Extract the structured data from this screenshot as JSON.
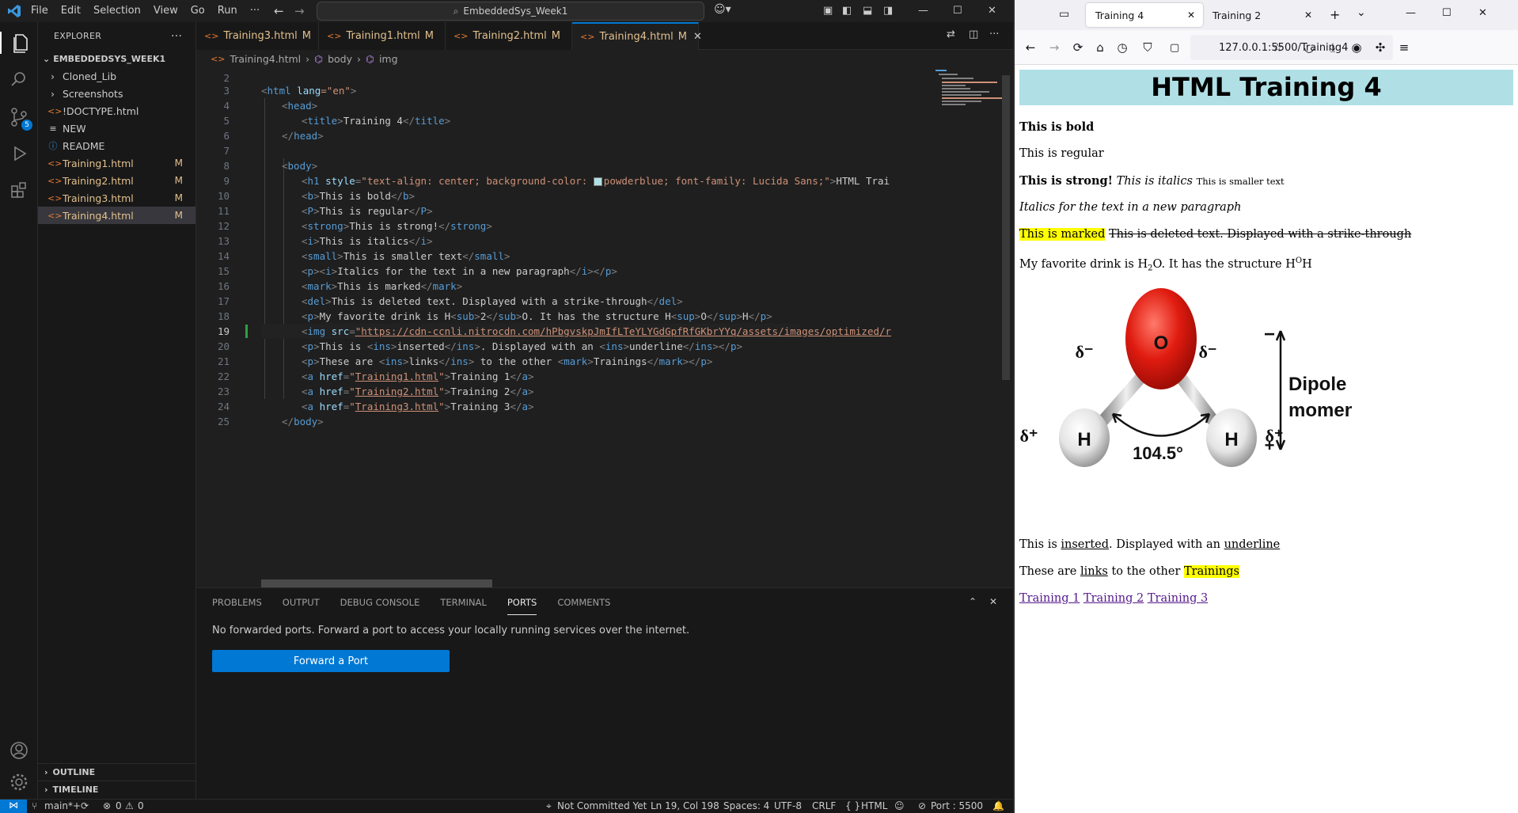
{
  "vscode": {
    "menu": [
      "File",
      "Edit",
      "Selection",
      "View",
      "Go",
      "Run",
      "···"
    ],
    "search_title": "EmbeddedSys_Week1",
    "explorer": {
      "header": "EXPLORER",
      "folder": "EMBEDDEDSYS_WEEK1",
      "items": [
        {
          "label": "Cloned_Lib",
          "kind": "folder",
          "status": ""
        },
        {
          "label": "Screenshots",
          "kind": "folder",
          "status": ""
        },
        {
          "label": "!DOCTYPE.html",
          "kind": "html",
          "status": ""
        },
        {
          "label": "NEW",
          "kind": "file",
          "status": ""
        },
        {
          "label": "README",
          "kind": "info",
          "status": ""
        },
        {
          "label": "Training1.html",
          "kind": "html",
          "status": "M"
        },
        {
          "label": "Training2.html",
          "kind": "html",
          "status": "M"
        },
        {
          "label": "Training3.html",
          "kind": "html",
          "status": "M"
        },
        {
          "label": "Training4.html",
          "kind": "html",
          "status": "M"
        }
      ],
      "outline": "OUTLINE",
      "timeline": "TIMELINE"
    },
    "source_control_badge": "5",
    "tabs": [
      {
        "label": "Training3.html",
        "mod": "M"
      },
      {
        "label": "Training1.html",
        "mod": "M"
      },
      {
        "label": "Training2.html",
        "mod": "M"
      },
      {
        "label": "Training4.html",
        "mod": "M"
      }
    ],
    "breadcrumb": [
      "Training4.html",
      "body",
      "img"
    ],
    "line_numbers": [
      "2",
      "3",
      "4",
      "5",
      "6",
      "7",
      "8",
      "9",
      "10",
      "11",
      "12",
      "13",
      "14",
      "15",
      "16",
      "17",
      "18",
      "19",
      "20",
      "21",
      "22",
      "23",
      "24",
      "25"
    ],
    "panel": {
      "tabs": [
        "PROBLEMS",
        "OUTPUT",
        "DEBUG CONSOLE",
        "TERMINAL",
        "PORTS",
        "COMMENTS"
      ],
      "active_tab": "PORTS",
      "message": "No forwarded ports. Forward a port to access your locally running services over the internet.",
      "button": "Forward a Port"
    },
    "status": {
      "branch": "main*+",
      "errors": "0",
      "warnings": "0",
      "commit": "Not Committed Yet",
      "position": "Ln 19, Col 198",
      "spaces": "Spaces: 4",
      "encoding": "UTF-8",
      "eol": "CRLF",
      "language": "HTML",
      "port": "Port : 5500"
    }
  },
  "code": {
    "l3a": "<",
    "l3b": "html",
    "l3c": " lang",
    "l3d": "=\"en\"",
    "l3e": ">",
    "l4": "head",
    "l5a": "title",
    "l5b": "Training 4",
    "l5c": "title",
    "l6": "head",
    "l8": "body",
    "l9a": "h1",
    "l9b": "style",
    "l9c": "\"text-align: center; background-color: ",
    "l9d": "powderblue; font-family: Lucida Sans;\"",
    "l9e": "HTML Trai",
    "l10a": "b",
    "l10b": "This is bold",
    "l10c": "b",
    "l11a": "P",
    "l11b": "This is regular",
    "l11c": "P",
    "l12a": "strong",
    "l12b": "This is strong!",
    "l12c": "strong",
    "l13a": "i",
    "l13b": "This is italics",
    "l13c": "i",
    "l14a": "small",
    "l14b": "This is smaller text",
    "l14c": "small",
    "l15a": "p",
    "l15b": "i",
    "l15c": "Italics for the text in a new paragraph",
    "l15d": "i",
    "l15e": "p",
    "l16a": "mark",
    "l16b": "This is marked",
    "l16c": "mark",
    "l17a": "del",
    "l17b": "This is deleted text. Displayed with a strike-through",
    "l17c": "del",
    "l18a": "p",
    "l18b": "My favorite drink is H",
    "l18c": "sub",
    "l18d": "2",
    "l18e": "sub",
    "l18f": "O. It has the structure H",
    "l18g": "sup",
    "l18h": "O",
    "l18i": "sup",
    "l18j": "H",
    "l18k": "p",
    "l19a": "img",
    "l19b": "src",
    "l19c": "\"https://cdn-ccnli.nitrocdn.com/hPbgvskpJmIfLTeYLYGdGpfRfGKbrYYq/assets/images/optimized/r",
    "l20a": "p",
    "l20b": "This is ",
    "l20c": "ins",
    "l20d": "inserted",
    "l20e": "ins",
    "l20f": ". Displayed with an ",
    "l20g": "ins",
    "l20h": "underline",
    "l20i": "ins",
    "l20j": "p",
    "l21a": "p",
    "l21b": "These are ",
    "l21c": "ins",
    "l21d": "links",
    "l21e": "ins",
    "l21f": " to the other ",
    "l21g": "mark",
    "l21h": "Trainings",
    "l21i": "mark",
    "l21j": "p",
    "l22a": "a",
    "l22b": "href",
    "l22c": "Training1.html",
    "l22d": "Training 1",
    "l22e": "a",
    "l23a": "a",
    "l23b": "href",
    "l23c": "Training2.html",
    "l23d": "Training 2",
    "l23e": "a",
    "l24a": "a",
    "l24b": "href",
    "l24c": "Training3.html",
    "l24d": "Training 3",
    "l24e": "a",
    "l25": "body"
  },
  "firefox": {
    "tabs": [
      "Training 4",
      "Training 2"
    ],
    "url": "127.0.0.1:5500/Training4",
    "page": {
      "h1": "HTML Training 4",
      "bold": "This is bold",
      "regular": "This is regular",
      "strong": "This is strong!",
      "italics": "This is italics",
      "small": "This is smaller text",
      "italic_para": "Italics for the text in a new paragraph",
      "marked": "This is marked",
      "deleted": "This is deleted text. Displayed with a strike-through",
      "drink_a": "My favorite drink is H",
      "drink_sub": "2",
      "drink_b": "O. It has the structure H",
      "drink_sup": "O",
      "drink_c": "H",
      "molecule": {
        "o": "O",
        "h1": "H",
        "h2": "H",
        "angle": "104.5°",
        "d_minus_l": "δ⁻",
        "d_minus_r": "δ⁻",
        "d_plus_l": "δ⁺",
        "d_plus_r": "δ⁺",
        "dipole1": "Dipole",
        "dipole2": "moment",
        "minus": "−",
        "plus": "+"
      },
      "ins_a": "This is ",
      "ins_b": "inserted",
      "ins_c": ". Displayed with an ",
      "ins_d": "underline",
      "links_a": "These are ",
      "links_b": "links",
      "links_c": " to the other ",
      "links_d": "Trainings",
      "link1": "Training 1",
      "link2": "Training 2",
      "link3": "Training 3"
    }
  },
  "colors": {
    "accent": "#0078d4",
    "modified": "#e2c08d",
    "powderblue": "#b0e0e6",
    "mark": "#ffff00"
  }
}
